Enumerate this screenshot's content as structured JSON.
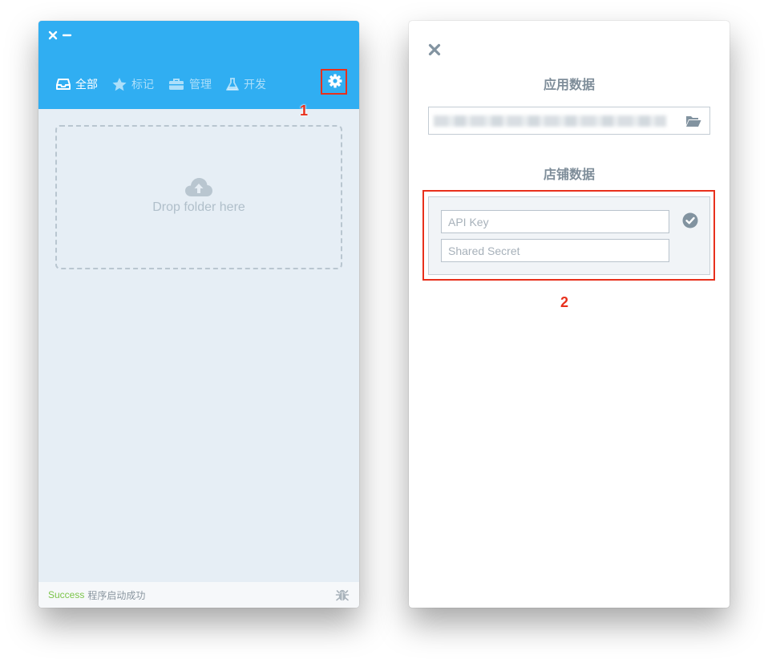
{
  "left_window": {
    "nav": [
      {
        "label": "全部",
        "icon": "inbox-icon",
        "active": true
      },
      {
        "label": "标记",
        "icon": "star-icon",
        "active": false
      },
      {
        "label": "管理",
        "icon": "briefcase-icon",
        "active": false
      },
      {
        "label": "开发",
        "icon": "flask-icon",
        "active": false
      }
    ],
    "settings_icon": "gear-icon",
    "dropzone_label": "Drop folder here",
    "status": {
      "level": "Success",
      "message": "程序启动成功"
    }
  },
  "right_panel": {
    "app_data_title": "应用数据",
    "store_data_title": "店铺数据",
    "api_key_placeholder": "API Key",
    "shared_secret_placeholder": "Shared Secret"
  },
  "annotations": {
    "one": "1",
    "two": "2"
  },
  "colors": {
    "titlebar": "#30aef2",
    "annotation": "#e8301c",
    "success": "#7bc44a"
  }
}
